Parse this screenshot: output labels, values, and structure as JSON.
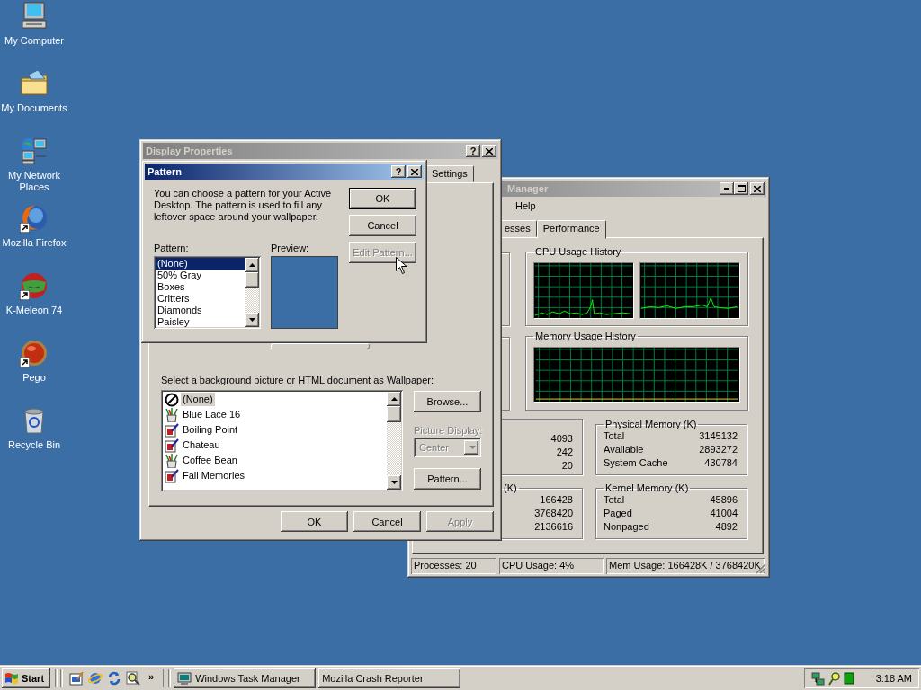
{
  "desktop_icons": [
    {
      "label": "My Computer",
      "shortcut": false
    },
    {
      "label": "My Documents",
      "shortcut": false
    },
    {
      "label": "My Network Places",
      "shortcut": false
    },
    {
      "label": "Mozilla Firefox",
      "shortcut": true
    },
    {
      "label": "K-Meleon 74",
      "shortcut": true
    },
    {
      "label": "Pego",
      "shortcut": true
    },
    {
      "label": "Recycle Bin",
      "shortcut": false
    }
  ],
  "task_manager": {
    "title": "Manager",
    "menu": [
      "Help"
    ],
    "tabs": [
      {
        "label": "esses",
        "selected": false
      },
      {
        "label": "Performance",
        "selected": true
      }
    ],
    "cpu_group": "CPU Usage History",
    "memory_group": "Memory Usage History",
    "totals_values": [
      "4093",
      "242",
      "20"
    ],
    "commit_group": "(K)",
    "commit_values": [
      "166428",
      "3768420",
      "2136616"
    ],
    "physical_memory": {
      "title": "Physical Memory (K)",
      "rows": [
        {
          "label": "Total",
          "value": "3145132"
        },
        {
          "label": "Available",
          "value": "2893272"
        },
        {
          "label": "System Cache",
          "value": "430784"
        }
      ]
    },
    "kernel_memory": {
      "title": "Kernel Memory (K)",
      "rows": [
        {
          "label": "Total",
          "value": "45896"
        },
        {
          "label": "Paged",
          "value": "41004"
        },
        {
          "label": "Nonpaged",
          "value": "4892"
        }
      ]
    },
    "status_bar": [
      "Processes: 20",
      "CPU Usage: 4%",
      "Mem Usage: 166428K / 3768420K"
    ]
  },
  "display_properties": {
    "title": "Display Properties",
    "help_button": "?",
    "tabs": [
      {
        "label": "Settings",
        "selected": false
      }
    ],
    "wallpaper_label": "Select a background picture or HTML document as Wallpaper:",
    "wallpapers": [
      {
        "label": "(None)",
        "kind": "none",
        "selected": true
      },
      {
        "label": "Blue Lace 16",
        "kind": "html",
        "selected": false
      },
      {
        "label": "Boiling Point",
        "kind": "image",
        "selected": false
      },
      {
        "label": "Chateau",
        "kind": "image",
        "selected": false
      },
      {
        "label": "Coffee Bean",
        "kind": "html",
        "selected": false
      },
      {
        "label": "Fall Memories",
        "kind": "image",
        "selected": false
      }
    ],
    "browse_button": "Browse...",
    "picture_display": {
      "label": "Picture Display:",
      "value": "Center",
      "disabled": true
    },
    "pattern_button": "Pattern...",
    "buttons": [
      {
        "label": "OK",
        "disabled": false
      },
      {
        "label": "Cancel",
        "disabled": false
      },
      {
        "label": "Apply",
        "disabled": true
      }
    ]
  },
  "pattern_dialog": {
    "title": "Pattern",
    "help_button": "?",
    "description": "You can choose a pattern for your Active Desktop. The pattern is used to fill any leftover space around your wallpaper.",
    "buttons": [
      {
        "label": "OK",
        "default": true,
        "disabled": false
      },
      {
        "label": "Cancel",
        "default": false,
        "disabled": false
      },
      {
        "label": "Edit Pattern...",
        "default": false,
        "disabled": true
      }
    ],
    "pattern_label": "Pattern:",
    "patterns": [
      {
        "label": "(None)",
        "selected": true
      },
      {
        "label": "50% Gray",
        "selected": false
      },
      {
        "label": "Boxes",
        "selected": false
      },
      {
        "label": "Critters",
        "selected": false
      },
      {
        "label": "Diamonds",
        "selected": false
      },
      {
        "label": "Paisley",
        "selected": false
      }
    ],
    "preview_label": "Preview:"
  },
  "taskbar": {
    "start": "Start",
    "overflow": "»",
    "tasks": [
      {
        "label": "Windows Task Manager",
        "has_icon": true
      },
      {
        "label": "Mozilla Crash Reporter",
        "has_icon": false
      }
    ],
    "clock": "3:18 AM"
  }
}
